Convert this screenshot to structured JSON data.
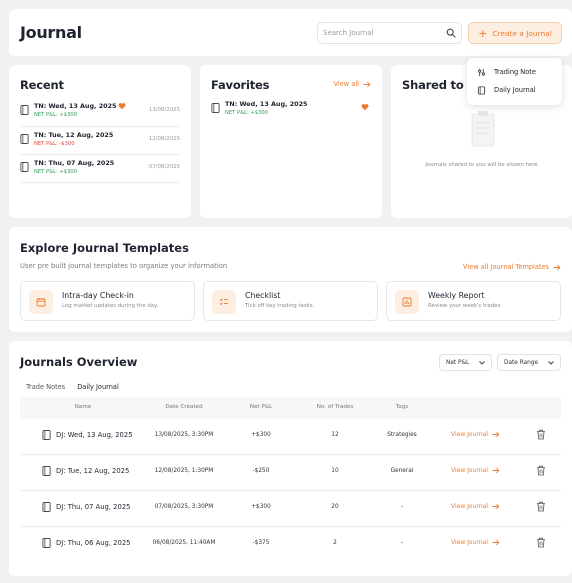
{
  "header": {
    "title": "Journal",
    "search_placeholder": "Search Journal",
    "create_label": "Create a Journal"
  },
  "create_menu": {
    "items": [
      {
        "label": "Trading Note",
        "icon": "sliders-icon"
      },
      {
        "label": "Daily Journal",
        "icon": "notebook-icon"
      }
    ]
  },
  "recent": {
    "title": "Recent",
    "items": [
      {
        "title": "TN: Wed, 13 Aug, 2025",
        "pnl": "NET P&L: +$300",
        "pnl_sign": "positive",
        "date": "13/08/2025",
        "favorite": true
      },
      {
        "title": "TN: Tue, 12 Aug, 2025",
        "pnl": "NET P&L: -$300",
        "pnl_sign": "negative",
        "date": "12/08/2025",
        "favorite": false
      },
      {
        "title": "TN: Thu, 07 Aug, 2025",
        "pnl": "NET P&L: +$300",
        "pnl_sign": "positive",
        "date": "07/08/2025",
        "favorite": false
      }
    ]
  },
  "favorites": {
    "title": "Favorites",
    "view_all": "View all",
    "items": [
      {
        "title": "TN: Wed, 13 Aug, 2025",
        "pnl": "NET P&L: +$300",
        "pnl_sign": "positive"
      }
    ]
  },
  "shared": {
    "title": "Shared to me",
    "empty_text": "Journals shared to you will be shown here"
  },
  "templates": {
    "title": "Explore Journal Templates",
    "subtitle": "User pre built journal templates to organize your information",
    "view_all": "View all Journal Templates",
    "items": [
      {
        "name": "Intra-day Check-in",
        "desc": "Log market updates during the day.",
        "icon": "calendar-icon"
      },
      {
        "name": "Checklist",
        "desc": "Tick off key trading tasks.",
        "icon": "checklist-icon"
      },
      {
        "name": "Weekly Report",
        "desc": "Review your week's trades.",
        "icon": "report-icon"
      }
    ]
  },
  "overview": {
    "title": "Journals Overview",
    "filter_pnl": "Net P&L",
    "filter_date": "Date Range",
    "tabs": [
      {
        "label": "Trade Notes",
        "active": false
      },
      {
        "label": "Daily Journal",
        "active": true
      }
    ],
    "columns": [
      "Name",
      "Date Created",
      "Net P&L",
      "No. of Trades",
      "Tags"
    ],
    "view_label": "View Journal",
    "rows": [
      {
        "name": "DJ: Wed, 13 Aug, 2025",
        "created": "13/08/2025, 3:30PM",
        "pnl": "+$300",
        "pnl_sign": "positive",
        "trades": "12",
        "tags": "Strategies"
      },
      {
        "name": "DJ: Tue, 12 Aug, 2025",
        "created": "12/08/2025, 1:30PM",
        "pnl": "-$250",
        "pnl_sign": "negative",
        "trades": "10",
        "tags": "General"
      },
      {
        "name": "DJ: Thu, 07 Aug, 2025",
        "created": "07/08/2025, 3:30PM",
        "pnl": "+$300",
        "pnl_sign": "positive",
        "trades": "20",
        "tags": "-"
      },
      {
        "name": "DJ: Thu, 06 Aug, 2025",
        "created": "06/08/2025, 11:40AM",
        "pnl": "-$375",
        "pnl_sign": "negative",
        "trades": "2",
        "tags": "-"
      }
    ]
  },
  "colors": {
    "accent": "#ee7a2f",
    "accent_bg": "#fdeee2",
    "positive": "#2f9e5a",
    "negative": "#e0443c"
  }
}
